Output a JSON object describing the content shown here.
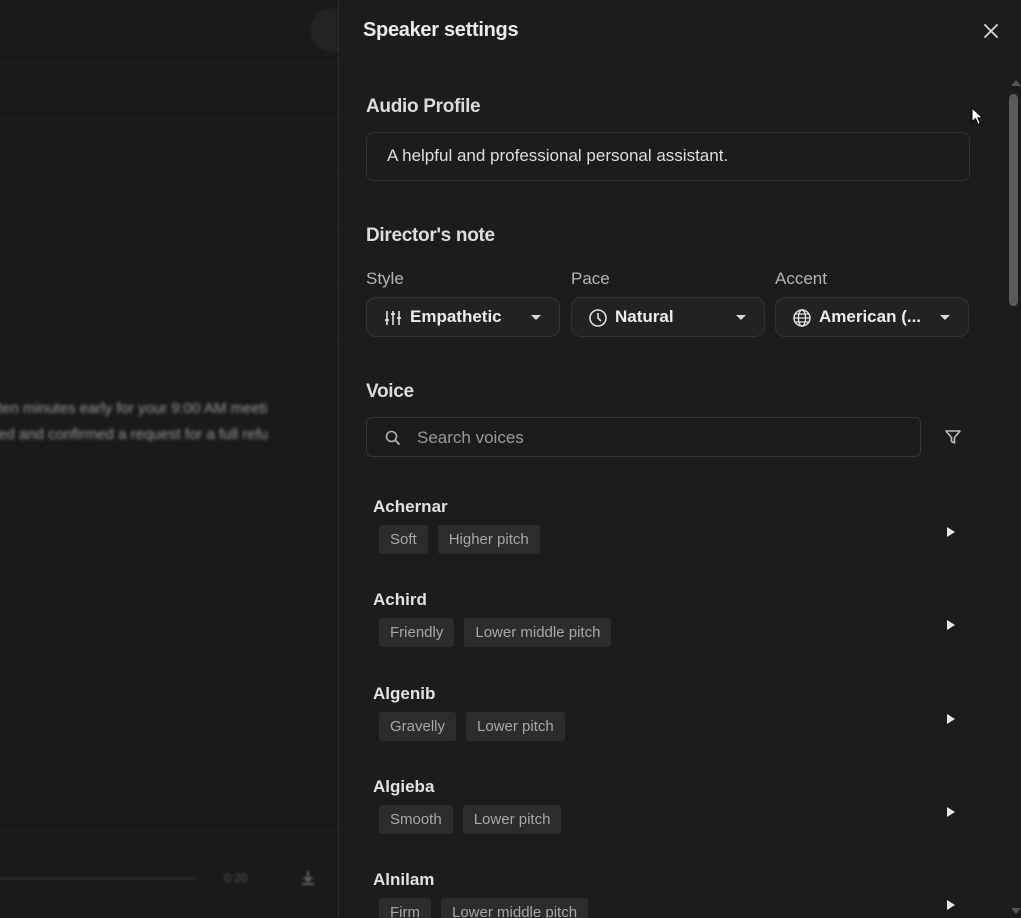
{
  "background": {
    "line1": "ten minutes early for your 9:00 AM meeti",
    "line2": "ed and confirmed a request for a full refu",
    "time": "0:20"
  },
  "panel": {
    "title": "Speaker settings",
    "audio_profile": {
      "heading": "Audio Profile",
      "value": "A helpful and professional personal assistant."
    },
    "directors_note": {
      "heading": "Director's note",
      "style": {
        "label": "Style",
        "value": "Empathetic"
      },
      "pace": {
        "label": "Pace",
        "value": "Natural"
      },
      "accent": {
        "label": "Accent",
        "value": "American (..."
      }
    },
    "voice": {
      "heading": "Voice",
      "search_placeholder": "Search voices",
      "items": [
        {
          "name": "Achernar",
          "tags": [
            "Soft",
            "Higher pitch"
          ]
        },
        {
          "name": "Achird",
          "tags": [
            "Friendly",
            "Lower middle pitch"
          ]
        },
        {
          "name": "Algenib",
          "tags": [
            "Gravelly",
            "Lower pitch"
          ]
        },
        {
          "name": "Algieba",
          "tags": [
            "Smooth",
            "Lower pitch"
          ]
        },
        {
          "name": "Alnilam",
          "tags": [
            "Firm",
            "Lower middle pitch"
          ]
        }
      ]
    }
  },
  "icons": {
    "close": "close-icon",
    "style": "sliders-icon",
    "pace": "clock-icon",
    "accent": "globe-icon",
    "search": "search-icon",
    "filter": "filter-icon",
    "play": "play-icon",
    "download": "download-icon"
  },
  "colors": {
    "panel_bg": "#1c1c1c",
    "page_bg": "#1b1b1b",
    "tag_bg": "#2c2c2c",
    "border": "#333333"
  }
}
